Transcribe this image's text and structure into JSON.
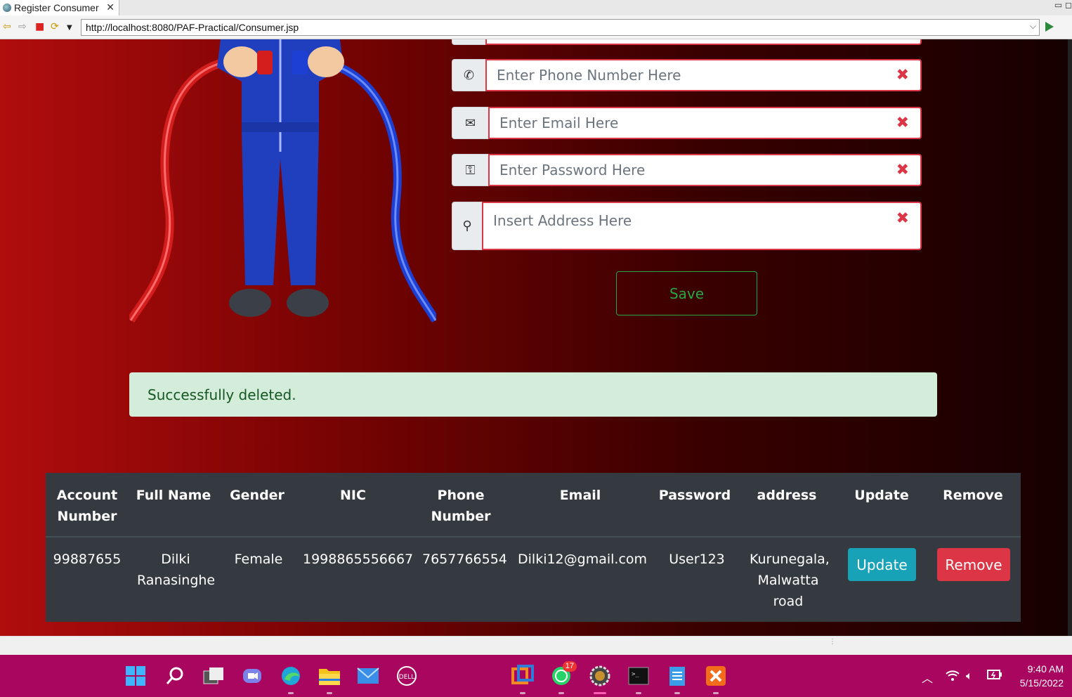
{
  "browser": {
    "tab_title": "Register Consumer",
    "url": "http://localhost:8080/PAF-Practical/Consumer.jsp"
  },
  "form": {
    "phone_placeholder": "Enter Phone Number Here",
    "email_placeholder": "Enter Email Here",
    "password_placeholder": "Enter Password Here",
    "address_placeholder": "Insert Address Here",
    "clear_glyph": "✖",
    "save_label": "Save"
  },
  "alert": {
    "message": "Successfully deleted."
  },
  "table": {
    "headers": [
      "Account Number",
      "Full Name",
      "Gender",
      "NIC",
      "Phone Number",
      "Email",
      "Password",
      "address",
      "Update",
      "Remove"
    ],
    "rows": [
      {
        "account_number": "99887655",
        "full_name": "Dilki Ranasinghe",
        "gender": "Female",
        "nic": "1998865556667",
        "phone": "7657766554",
        "email": "Dilki12@gmail.com",
        "password": "User123",
        "address": "Kurunegala, Malwatta road",
        "update_label": "Update",
        "remove_label": "Remove"
      }
    ]
  },
  "taskbar": {
    "whatsapp_badge": "17",
    "time": "9:40 AM",
    "date": "5/15/2022"
  },
  "colors": {
    "error_border": "#dc3545",
    "success_green": "#28a745",
    "info_button": "#17a2b8",
    "taskbar": "#a8065f"
  }
}
